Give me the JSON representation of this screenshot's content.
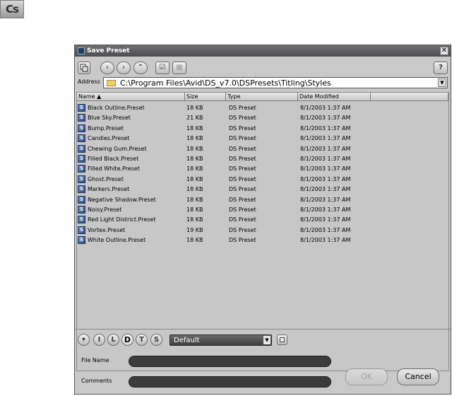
{
  "logo": {
    "text": "Cs"
  },
  "dialog": {
    "title": "Save Preset",
    "close_glyph": "✕",
    "toolbar": {
      "view_icon": "view-list-icon",
      "back_glyph": "‹",
      "forward_glyph": "›",
      "up_glyph": "⌃",
      "check_glyph": "☑",
      "grid_glyph": "▦",
      "help_glyph": "?"
    },
    "address": {
      "label": "Address",
      "value": "C:\\Program Files\\Avid\\DS_v7.0\\DSPresets\\Titling\\Styles",
      "dropdown_glyph": "▼"
    },
    "columns": [
      "Name ▲",
      "Size",
      "Type",
      "Date Modified"
    ],
    "files": [
      {
        "name": "Black Outline.Preset",
        "size": "18 KB",
        "type": "DS Preset",
        "modified": "8/1/2003 1:37 AM"
      },
      {
        "name": "Blue Sky.Preset",
        "size": "21 KB",
        "type": "DS Preset",
        "modified": "8/1/2003 1:37 AM"
      },
      {
        "name": "Bump.Preset",
        "size": "18 KB",
        "type": "DS Preset",
        "modified": "8/1/2003 1:37 AM"
      },
      {
        "name": "Candies.Preset",
        "size": "18 KB",
        "type": "DS Preset",
        "modified": "8/1/2003 1:37 AM"
      },
      {
        "name": "Chewing Gum.Preset",
        "size": "18 KB",
        "type": "DS Preset",
        "modified": "8/1/2003 1:37 AM"
      },
      {
        "name": "Filled Black.Preset",
        "size": "18 KB",
        "type": "DS Preset",
        "modified": "8/1/2003 1:37 AM"
      },
      {
        "name": "Filled White.Preset",
        "size": "18 KB",
        "type": "DS Preset",
        "modified": "8/1/2003 1:37 AM"
      },
      {
        "name": "Ghost.Preset",
        "size": "18 KB",
        "type": "DS Preset",
        "modified": "8/1/2003 1:37 AM"
      },
      {
        "name": "Markers.Preset",
        "size": "18 KB",
        "type": "DS Preset",
        "modified": "8/1/2003 1:37 AM"
      },
      {
        "name": "Negative Shadow.Preset",
        "size": "18 KB",
        "type": "DS Preset",
        "modified": "8/1/2003 1:37 AM"
      },
      {
        "name": "Noisy.Preset",
        "size": "18 KB",
        "type": "DS Preset",
        "modified": "8/1/2003 1:37 AM"
      },
      {
        "name": "Red Light District.Preset",
        "size": "18 KB",
        "type": "DS Preset",
        "modified": "8/1/2003 1:37 AM"
      },
      {
        "name": "Vortex.Preset",
        "size": "19 KB",
        "type": "DS Preset",
        "modified": "8/1/2003 1:37 AM"
      },
      {
        "name": "White Outline.Preset",
        "size": "18 KB",
        "type": "DS Preset",
        "modified": "8/1/2003 1:37 AM"
      }
    ],
    "file_icon_glyph": "S",
    "bottom": {
      "menu_glyph": "▾",
      "filter_buttons": [
        "I",
        "L",
        "D",
        "T",
        "S"
      ],
      "active_filter": "D",
      "preset_value": "Default",
      "preset_dropdown_glyph": "▼",
      "file_name_label": "File Name",
      "file_name_value": "",
      "comments_label": "Comments",
      "comments_value": "",
      "ok_label": "OK",
      "cancel_label": "Cancel"
    }
  }
}
